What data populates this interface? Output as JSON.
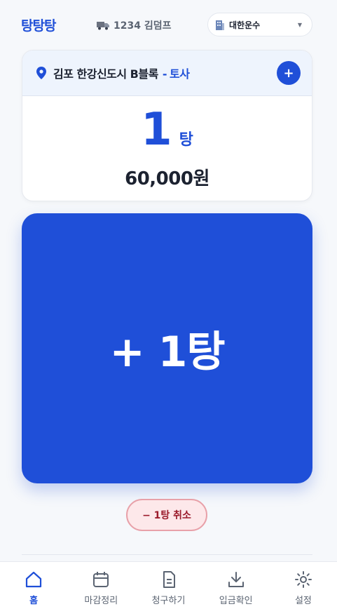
{
  "header": {
    "logo": "탕탕탕",
    "vehicle": "1234 김덤프",
    "company": "대한운수"
  },
  "site": {
    "location": "김포 한강신도시 B블록",
    "separator": "-",
    "material": "토사",
    "count": "1",
    "count_unit": "탕",
    "amount": "60,000원"
  },
  "actions": {
    "add_trip": "+ 1탕",
    "cancel_trip": "− 1탕 취소"
  },
  "nav": {
    "items": [
      {
        "label": "홈",
        "icon": "home-icon",
        "active": true
      },
      {
        "label": "마감정리",
        "icon": "calendar-icon"
      },
      {
        "label": "청구하기",
        "icon": "document-icon"
      },
      {
        "label": "입금확인",
        "icon": "download-icon"
      },
      {
        "label": "설정",
        "icon": "gear-icon"
      }
    ]
  },
  "colors": {
    "accent": "#1f4fd8",
    "danger_bg": "#fde8ea",
    "danger_text": "#9b1c2c"
  }
}
